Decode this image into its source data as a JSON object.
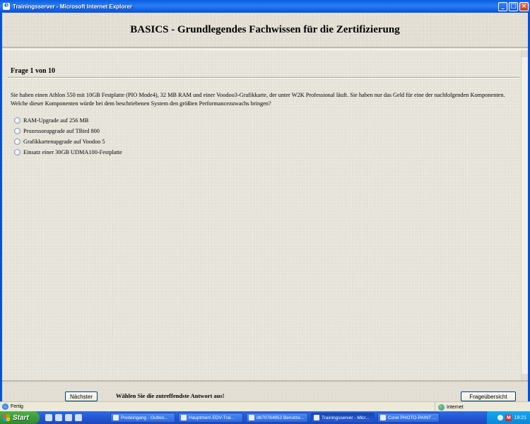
{
  "window": {
    "title": "Trainingsserver - Microsoft Internet Explorer",
    "minimize": "_",
    "maximize": "□",
    "close": "×"
  },
  "header": {
    "title": "BASICS - Grundlegendes Fachwissen für die Zertifizierung"
  },
  "question": {
    "counter": "Frage 1 von 10",
    "text": "Sie haben einen Athlon 550 mit 10GB Festplatte (PIO Mode4), 32 MB RAM und einer Voodoo3-Grafikkarte, der unter W2K Professional läuft. Sie haben nur das Geld für eine der nachfolgenden Komponenten. Welche dieser Komponenten würde bei dem beschriebenen System den größten Performancezuwachs bringen?",
    "answers": [
      "RAM-Upgrade auf 256 MB",
      "Prozessorupgrade auf TBird 800",
      "Grafikkartenupgrade auf Voodoo 5",
      "Einsatz einer 30GB UDMA100-Festplatte"
    ]
  },
  "footer": {
    "next_label": "Nächster",
    "hint": "Wählen Sie die zutreffendste Antwort aus!",
    "overview_label": "Frageübersicht"
  },
  "statusbar": {
    "status": "Fertig",
    "zone": "Internet"
  },
  "taskbar": {
    "start": "Start",
    "tasks": [
      "Posteingang - Outloo...",
      "Hauptmen\\ EDV-Trai...",
      "db70784952.Benutze...",
      "Trainingsserver - Micr...",
      "Corel PHOTO-PAINT ..."
    ],
    "clock": "19:21"
  }
}
